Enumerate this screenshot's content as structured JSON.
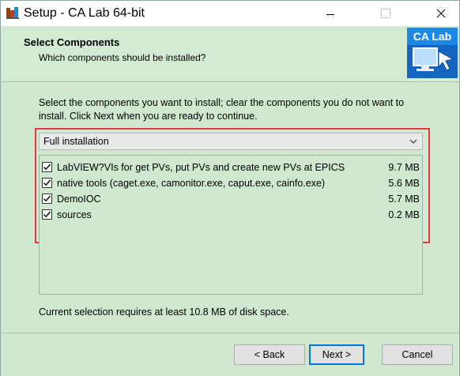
{
  "window": {
    "title": "Setup - CA Lab 64-bit",
    "icon": "setup-icon"
  },
  "header": {
    "title": "Select Components",
    "subtitle": "Which components should be installed?",
    "logo_text": "CA Lab"
  },
  "body": {
    "intro": "Select the components you want to install; clear the components you do not want to install. Click Next when you are ready to continue.",
    "install_type": "Full installation",
    "components": [
      {
        "label": "LabVIEW?VIs for get PVs, put PVs and create new PVs at EPICS",
        "size": "9.7 MB",
        "checked": true
      },
      {
        "label": "native tools (caget.exe, camonitor.exe, caput.exe, cainfo.exe)",
        "size": "5.6 MB",
        "checked": true
      },
      {
        "label": "DemoIOC",
        "size": "5.7 MB",
        "checked": true
      },
      {
        "label": "sources",
        "size": "0.2 MB",
        "checked": true
      }
    ],
    "disk_space_text": "Current selection requires at least 10.8 MB of disk space."
  },
  "buttons": {
    "back": "< Back",
    "next": "Next >",
    "cancel": "Cancel"
  },
  "colors": {
    "background": "#cfe8cf",
    "highlight_border": "#e0383e",
    "default_button_border": "#0078d7"
  }
}
